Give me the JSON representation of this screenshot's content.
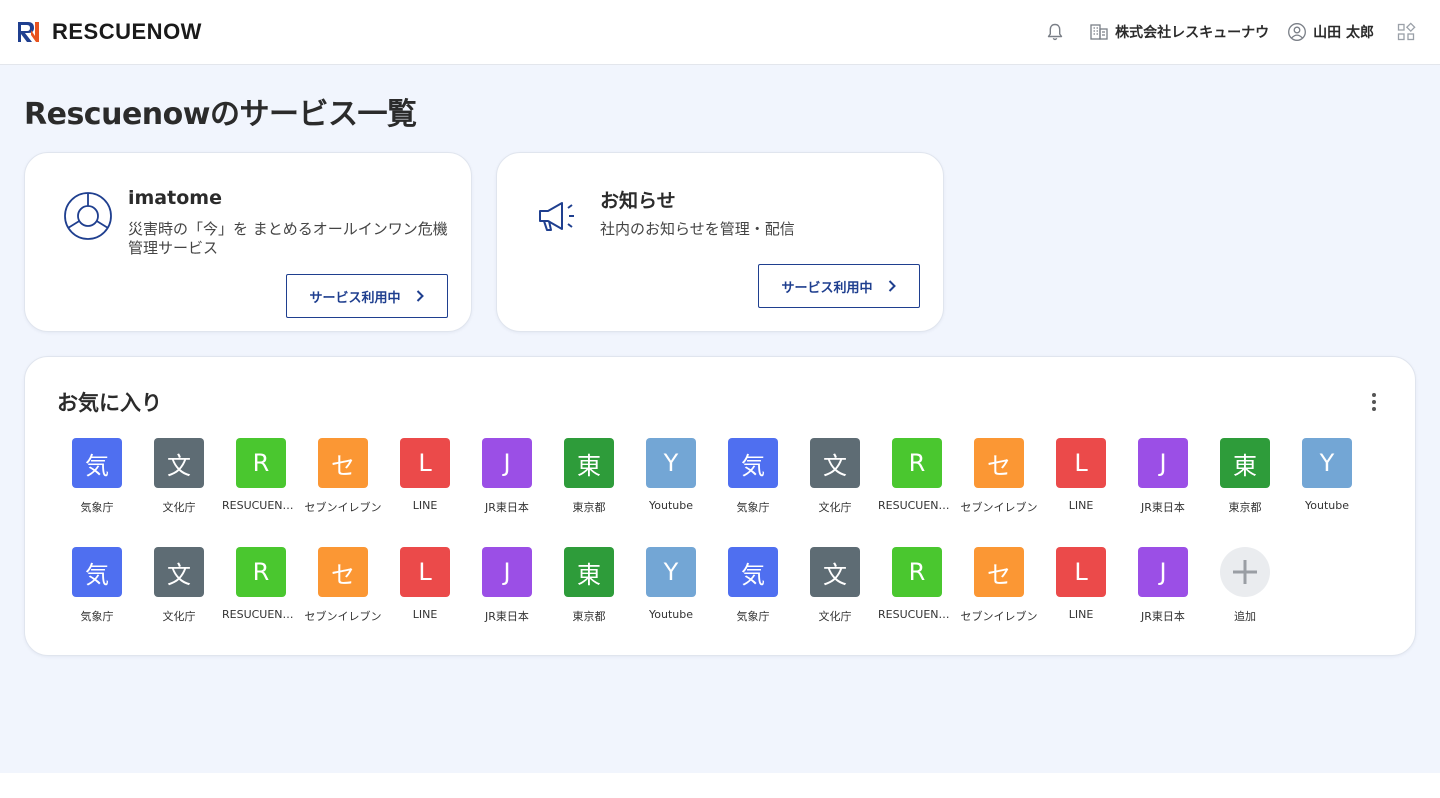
{
  "header": {
    "logo_text": "RESCUENOW",
    "company": "株式会社レスキューナウ",
    "user": "山田 太郎"
  },
  "page_title": "Rescuenowのサービス一覧",
  "services": [
    {
      "name": "imatome",
      "description": "災害時の「今」を まとめるオールインワン危機管理サービス",
      "button": "サービス利用中"
    },
    {
      "name": "お知らせ",
      "description": "社内のお知らせを管理・配信",
      "button": "サービス利用中"
    }
  ],
  "favorites": {
    "title": "お気に入り",
    "apps": [
      {
        "glyph": "気",
        "label": "気象庁",
        "color": "#4f6ff0"
      },
      {
        "glyph": "文",
        "label": "文化庁",
        "color": "#5e6c74"
      },
      {
        "glyph": "R",
        "label": "RESUCUENOW",
        "color": "#4ac72f"
      },
      {
        "glyph": "セ",
        "label": "セブンイレブン",
        "color": "#fb9734"
      },
      {
        "glyph": "L",
        "label": "LINE",
        "color": "#eb4a4a"
      },
      {
        "glyph": "J",
        "label": "JR東日本",
        "color": "#9b4fe6"
      },
      {
        "glyph": "東",
        "label": "東京都",
        "color": "#2e9c3a"
      },
      {
        "glyph": "Y",
        "label": "Youtube",
        "color": "#73a6d5"
      },
      {
        "glyph": "気",
        "label": "気象庁",
        "color": "#4f6ff0"
      },
      {
        "glyph": "文",
        "label": "文化庁",
        "color": "#5e6c74"
      },
      {
        "glyph": "R",
        "label": "RESUCUENOW",
        "color": "#4ac72f"
      },
      {
        "glyph": "セ",
        "label": "セブンイレブン",
        "color": "#fb9734"
      },
      {
        "glyph": "L",
        "label": "LINE",
        "color": "#eb4a4a"
      },
      {
        "glyph": "J",
        "label": "JR東日本",
        "color": "#9b4fe6"
      },
      {
        "glyph": "東",
        "label": "東京都",
        "color": "#2e9c3a"
      },
      {
        "glyph": "Y",
        "label": "Youtube",
        "color": "#73a6d5"
      },
      {
        "glyph": "気",
        "label": "気象庁",
        "color": "#4f6ff0"
      },
      {
        "glyph": "文",
        "label": "文化庁",
        "color": "#5e6c74"
      },
      {
        "glyph": "R",
        "label": "RESUCUENOW",
        "color": "#4ac72f"
      },
      {
        "glyph": "セ",
        "label": "セブンイレブン",
        "color": "#fb9734"
      },
      {
        "glyph": "L",
        "label": "LINE",
        "color": "#eb4a4a"
      },
      {
        "glyph": "J",
        "label": "JR東日本",
        "color": "#9b4fe6"
      },
      {
        "glyph": "東",
        "label": "東京都",
        "color": "#2e9c3a"
      },
      {
        "glyph": "Y",
        "label": "Youtube",
        "color": "#73a6d5"
      },
      {
        "glyph": "気",
        "label": "気象庁",
        "color": "#4f6ff0"
      },
      {
        "glyph": "文",
        "label": "文化庁",
        "color": "#5e6c74"
      },
      {
        "glyph": "R",
        "label": "RESUCUENOW",
        "color": "#4ac72f"
      },
      {
        "glyph": "セ",
        "label": "セブンイレブン",
        "color": "#fb9734"
      },
      {
        "glyph": "L",
        "label": "LINE",
        "color": "#eb4a4a"
      },
      {
        "glyph": "J",
        "label": "JR東日本",
        "color": "#9b4fe6"
      }
    ],
    "add_label": "追加"
  },
  "icons": {
    "notifications": "bell-icon",
    "company": "building-icon",
    "user": "user-circle-icon",
    "apps_menu": "apps-grid-icon",
    "favorites_menu": "more-vertical-icon",
    "imatome": "imatome-logo-icon",
    "notice": "megaphone-icon",
    "button_arrow": "chevron-right-icon",
    "add": "plus-icon"
  },
  "colors": {
    "brand_blue": "#1f3f8f",
    "brand_orange": "#e8531f",
    "background": "#f1f5fd"
  }
}
